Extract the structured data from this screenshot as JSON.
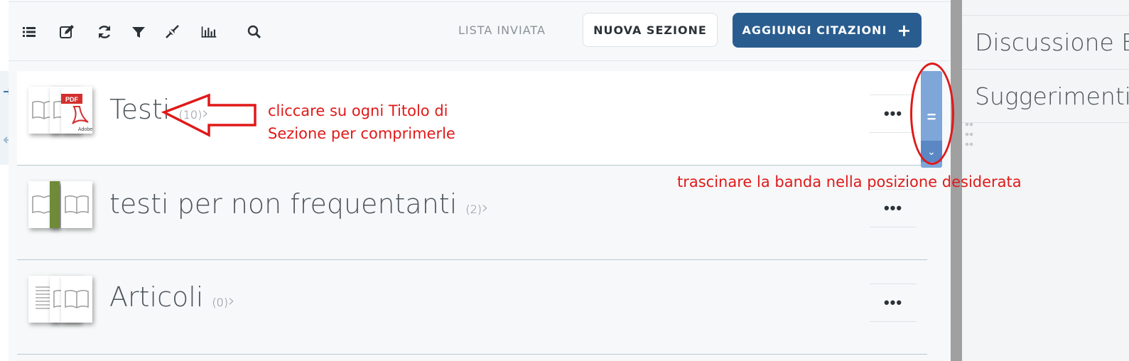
{
  "toolbar": {
    "icons": [
      "list-icon",
      "edit-icon",
      "refresh-icon",
      "filter-icon",
      "collapse-icon",
      "chart-icon",
      "search-icon"
    ],
    "lista_inviata": "LISTA INVIATA",
    "nuova_sezione": "NUOVA SEZIONE",
    "aggiungi_citazioni": "AGGIUNGI CITAZIONI",
    "aggiungi_plus": "+"
  },
  "sections": [
    {
      "title": "Testi",
      "count": "(10)",
      "chevron": "›",
      "more": "•••",
      "thumbs": [
        "book-icon",
        "pdf-icon"
      ]
    },
    {
      "title": "testi per non frequentanti",
      "count": "(2)",
      "chevron": "›",
      "more": "•••",
      "thumbs": [
        "book-icon",
        "book-icon"
      ]
    },
    {
      "title": "Articoli",
      "count": "(0)",
      "chevron": "›",
      "more": "•••",
      "thumbs": [
        "document-icon",
        "book-icon"
      ]
    }
  ],
  "drag_band": {
    "symbol": "=",
    "chevron": "⌄"
  },
  "right_panel": {
    "items": [
      "Discussione B",
      "Suggerimenti"
    ]
  },
  "annotations": {
    "click_title": "cliccare su ogni Titolo di Sezione per comprimerle",
    "drag_band": "trascinare la banda nella posizione desiderata"
  },
  "colors": {
    "primary_button": "#2a5d8f",
    "drag_band": "#7ea6d9",
    "annotation_red": "#e01919"
  }
}
